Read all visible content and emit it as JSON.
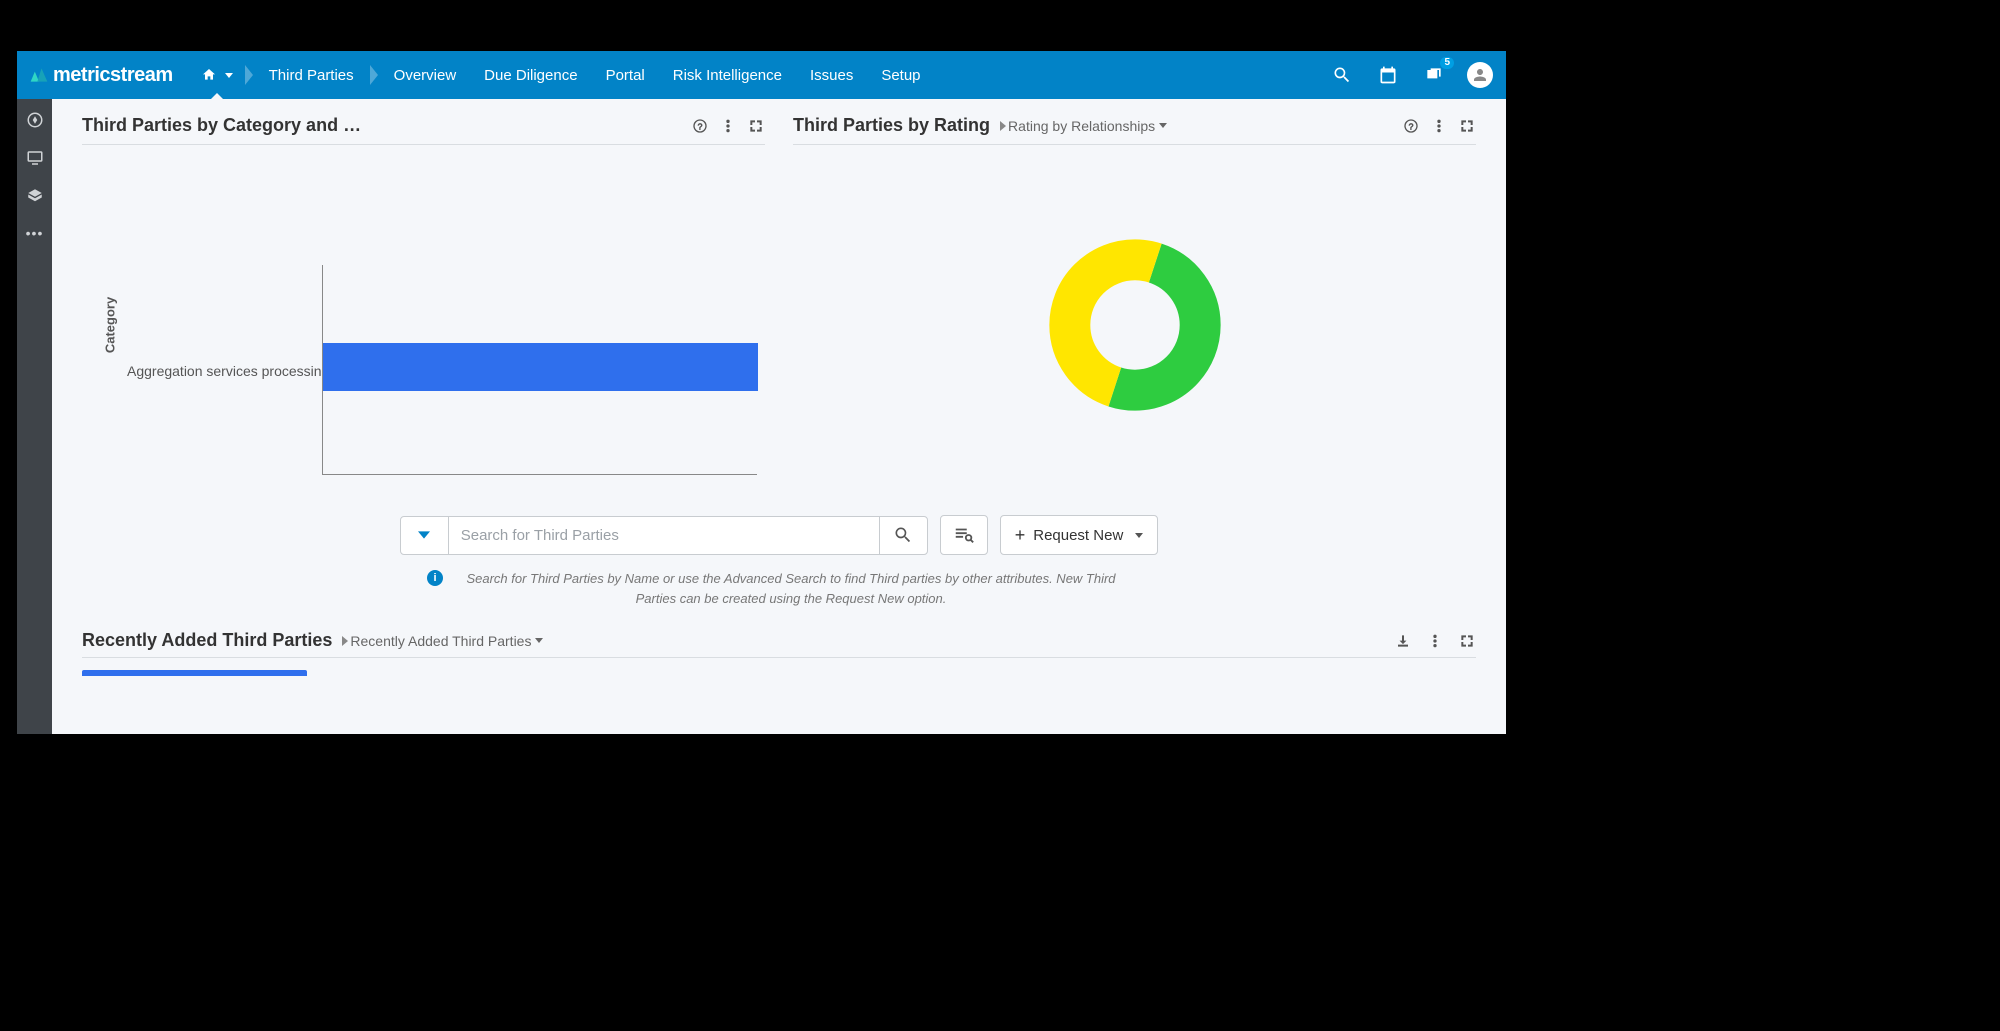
{
  "brand": {
    "name": "metricstream"
  },
  "nav": {
    "items": [
      "Third Parties",
      "Overview",
      "Due Diligence",
      "Portal",
      "Risk Intelligence",
      "Issues",
      "Setup"
    ],
    "notification_count": "5"
  },
  "widgets": {
    "left": {
      "title": "Third Parties by Category and Critical..."
    },
    "right": {
      "title": "Third Parties by Rating",
      "dropdown": "Rating by Relationships"
    }
  },
  "chart_data": [
    {
      "type": "bar",
      "orientation": "horizontal",
      "title": "Third Parties by Category and Criticality",
      "ylabel": "Category",
      "categories": [
        "Aggregation services processing"
      ],
      "values": [
        1
      ],
      "xlim": [
        0,
        1
      ]
    },
    {
      "type": "pie",
      "variant": "donut",
      "title": "Third Parties by Rating",
      "series": [
        {
          "name": "Green",
          "value": 50,
          "color": "#2ecc40"
        },
        {
          "name": "Yellow",
          "value": 50,
          "color": "#ffe600"
        }
      ]
    }
  ],
  "search": {
    "placeholder": "Search for Third Parties",
    "request_label": "Request New",
    "hint": "Search for Third Parties by Name or use the Advanced Search to find Third parties by other attributes. New Third Parties can be created using the Request New option."
  },
  "recent": {
    "title": "Recently Added Third Parties",
    "dropdown": "Recently Added Third Parties"
  }
}
